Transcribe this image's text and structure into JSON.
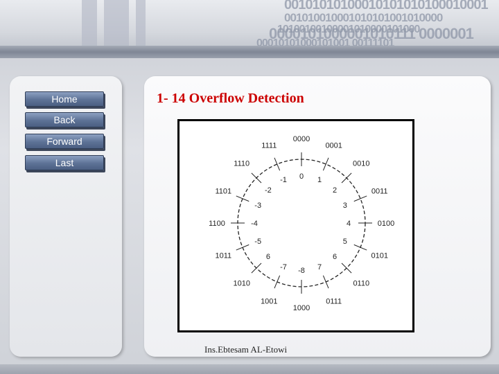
{
  "banner": {
    "binary_lines": [
      "00101010100010101010100010001",
      "001010010001010101001010000",
      "10100100100001010000101000",
      "0000101000001010111 0000001",
      "00010101000101001 00111101"
    ]
  },
  "nav": {
    "buttons": [
      "Home",
      "Back",
      "Forward",
      "Last"
    ]
  },
  "slide": {
    "title": "1- 14 Overflow Detection",
    "footer": "Ins.Ebtesam AL-Etowi"
  },
  "diagram": {
    "binary_labels": [
      "0000",
      "0001",
      "0010",
      "0011",
      "0100",
      "0101",
      "0110",
      "0111",
      "1000",
      "1001",
      "1010",
      "1011",
      "1100",
      "1101",
      "1110",
      "1111"
    ],
    "signed_labels": [
      "0",
      "1",
      "2",
      "3",
      "4",
      "5",
      "6",
      "7",
      "-8",
      "-7",
      "6",
      "-5",
      "-4",
      "-3",
      "-2",
      "-1"
    ]
  },
  "colors": {
    "title": "#cc0000",
    "button_top": "#8da1c2",
    "button_bottom": "#4b5f82",
    "frame": "#000000"
  }
}
